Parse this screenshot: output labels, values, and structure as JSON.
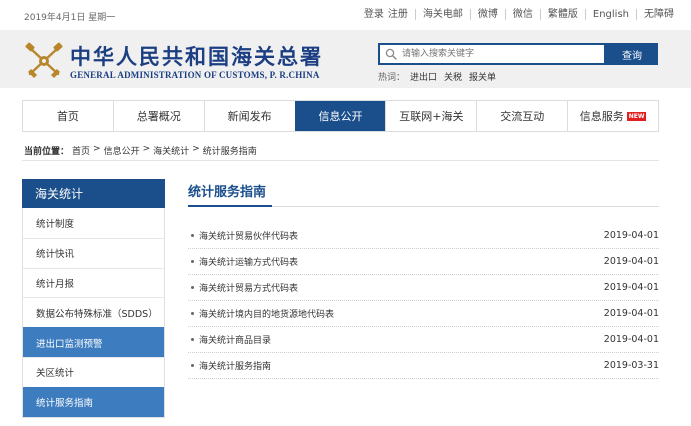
{
  "top": {
    "date": "2019年4月1日 星期一",
    "login": "登录",
    "register": "注册",
    "links": [
      "海关电邮",
      "微博",
      "微信",
      "繁體版",
      "English",
      "无障碍"
    ]
  },
  "header": {
    "title_cn": "中华人民共和国海关总署",
    "title_en": "GENERAL ADMINISTRATION OF CUSTOMS, P. R.CHINA",
    "search_placeholder": "请输入搜索关键字",
    "search_button": "查询",
    "hot_label": "热词：",
    "hot_words": [
      "进出口",
      "关税",
      "报关单"
    ]
  },
  "nav": {
    "items": [
      {
        "label": "首页"
      },
      {
        "label": "总署概况"
      },
      {
        "label": "新闻发布"
      },
      {
        "label": "信息公开"
      },
      {
        "label": "互联网+海关"
      },
      {
        "label": "交流互动"
      },
      {
        "label": "信息服务",
        "badge": "NEW"
      }
    ],
    "active_index": 3
  },
  "breadcrumb": {
    "label": "当前位置：",
    "path": [
      "首页",
      ">",
      "信息公开",
      ">",
      "海关统计",
      ">",
      "统计服务指南"
    ]
  },
  "sidebar": {
    "title": "海关统计",
    "items": [
      {
        "label": "统计制度"
      },
      {
        "label": "统计快讯"
      },
      {
        "label": "统计月报"
      },
      {
        "label": "数据公布特殊标准（SDDS）"
      },
      {
        "label": "进出口监测预警",
        "highlight": true
      },
      {
        "label": "关区统计"
      },
      {
        "label": "统计服务指南",
        "highlight": true
      }
    ]
  },
  "main": {
    "title": "统计服务指南",
    "rows": [
      {
        "title": "海关统计贸易伙伴代码表",
        "date": "2019-04-01"
      },
      {
        "title": "海关统计运输方式代码表",
        "date": "2019-04-01"
      },
      {
        "title": "海关统计贸易方式代码表",
        "date": "2019-04-01"
      },
      {
        "title": "海关统计境内目的地货源地代码表",
        "date": "2019-04-01"
      },
      {
        "title": "海关统计商品目录",
        "date": "2019-04-01"
      },
      {
        "title": "海关统计服务指南",
        "date": "2019-03-31"
      }
    ]
  },
  "colors": {
    "primary": "#1b4f8c",
    "highlight": "#3c7cbf",
    "badge": "#e02020",
    "header_bg": "#f0f0f0"
  },
  "icons": {
    "emblem": "customs-emblem-icon",
    "search": "search-icon",
    "bullet": "bullet-icon"
  }
}
